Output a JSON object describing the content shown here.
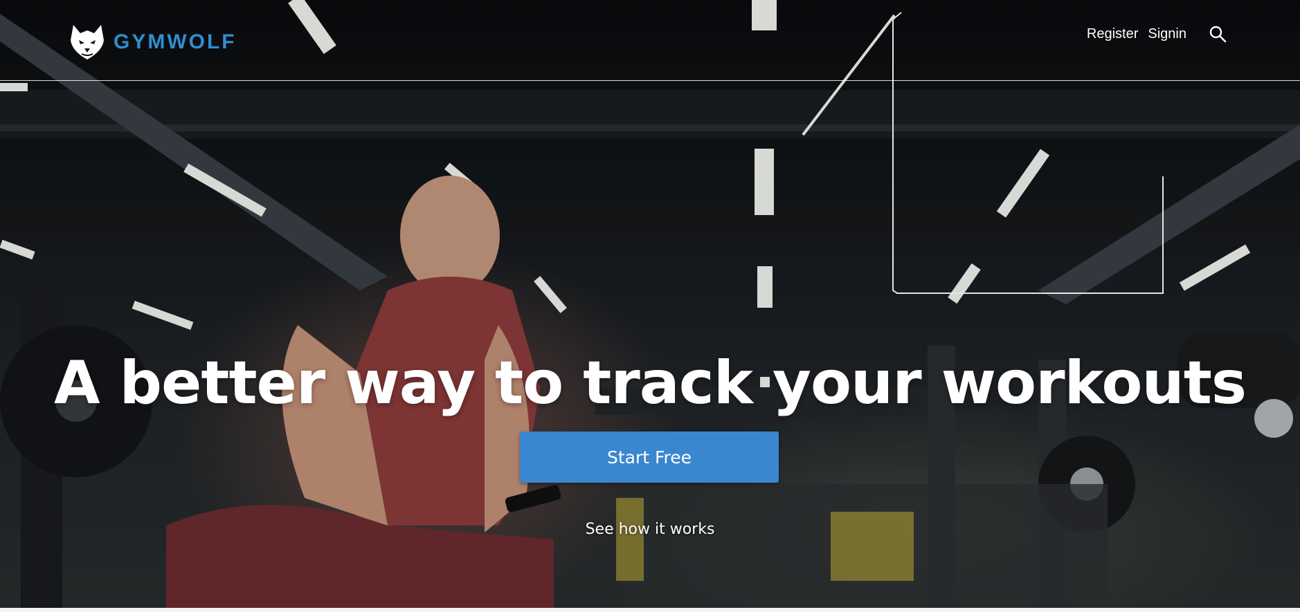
{
  "brand": {
    "name": "GYMWOLF",
    "logo_icon": "wolf-head-icon",
    "color": "#2f8ed0"
  },
  "nav": {
    "links": [
      {
        "label": "Register"
      },
      {
        "label": "Signin"
      }
    ],
    "search_icon": "search-icon"
  },
  "hero": {
    "headline": "A better way to track your workouts",
    "cta_label": "Start Free",
    "cta_color": "#3a87cf",
    "secondary_link": "See how it works"
  }
}
